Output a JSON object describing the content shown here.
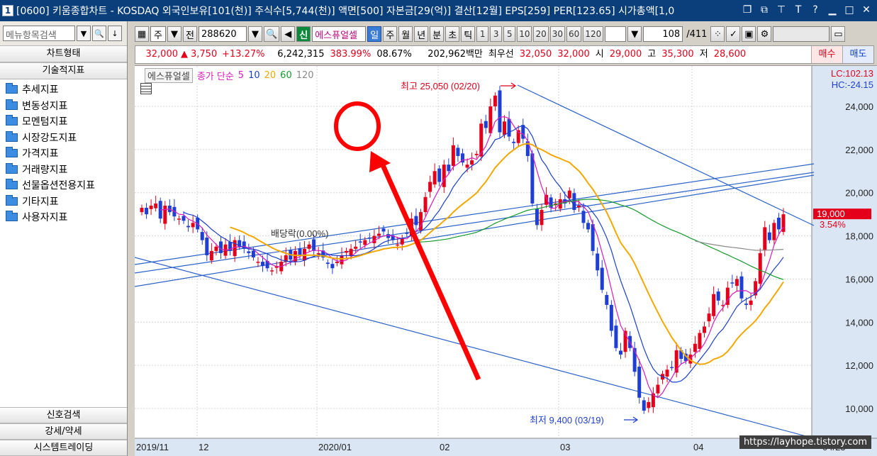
{
  "window": {
    "number": "1",
    "title": "[0600] 키움종합차트 - KOSDAQ 외국인보유[101(천)] 주식수[5,744(천)] 액면[500] 자본금[29(억)] 결산[12월] EPS[259] PER[123.65] 시가총액[1,0"
  },
  "left": {
    "search_placeholder": "메뉴항목검색",
    "chart_type": "차트형태",
    "tech_indicators": "기술적지표",
    "items": [
      "추세지표",
      "변동성지표",
      "모멘텀지표",
      "시장강도지표",
      "가격지표",
      "거래량지표",
      "선물옵션전용지표",
      "기타지표",
      "사용자지표"
    ],
    "bottom": [
      "신호검색",
      "강세/약세",
      "시스템트레이딩"
    ]
  },
  "toolbar": {
    "mode": "주",
    "prev": "전",
    "code": "288620",
    "new_badge": "신",
    "name": "에스퓨얼셀",
    "periods": [
      "일",
      "주",
      "월",
      "년",
      "분",
      "초",
      "틱"
    ],
    "nums": [
      "1",
      "3",
      "5",
      "10",
      "20",
      "30",
      "60",
      "120"
    ],
    "page": "108",
    "page_total": "/411"
  },
  "info": {
    "price": "32,000",
    "change": "3,750",
    "change_pct": "+13.27%",
    "volume": "6,242,315",
    "vol_ratio": "383.99%",
    "turnover": "08.67%",
    "amount": "202,962백만",
    "best_label": "최우선",
    "ask": "32,050",
    "bid": "32,000",
    "open_label": "시",
    "open": "29,000",
    "high_label": "고",
    "high": "35,300",
    "low_label": "저",
    "low": "28,600",
    "buy": "매수",
    "sell": "매도"
  },
  "legend": {
    "name": "에스퓨얼셀",
    "ma_label": "종가 단순",
    "ma": [
      "5",
      "10",
      "20",
      "60",
      "120"
    ],
    "ma_colors": [
      "#d81cba",
      "#1a3fcf",
      "#f2a800",
      "#169b2e",
      "#8a8a8a"
    ]
  },
  "chart_data": {
    "type": "candlestick",
    "y_ticks": [
      "24,000",
      "22,000",
      "20,000",
      "18,000",
      "16,000",
      "14,000",
      "12,000",
      "10,000"
    ],
    "x_ticks": [
      "2019/11",
      "12",
      "2020/01",
      "02",
      "03",
      "04",
      "04/23"
    ],
    "lc": "LC:102.13",
    "hc": "HC:-24.15",
    "high_label": "최고 25,050 (02/20)",
    "low_label": "최저 9,400 (03/19)",
    "dividend_label": "배당락(0.00%)",
    "current_price": "19,000",
    "current_pct": "3.54%"
  },
  "watermark": "https://layhope.tistory.com"
}
